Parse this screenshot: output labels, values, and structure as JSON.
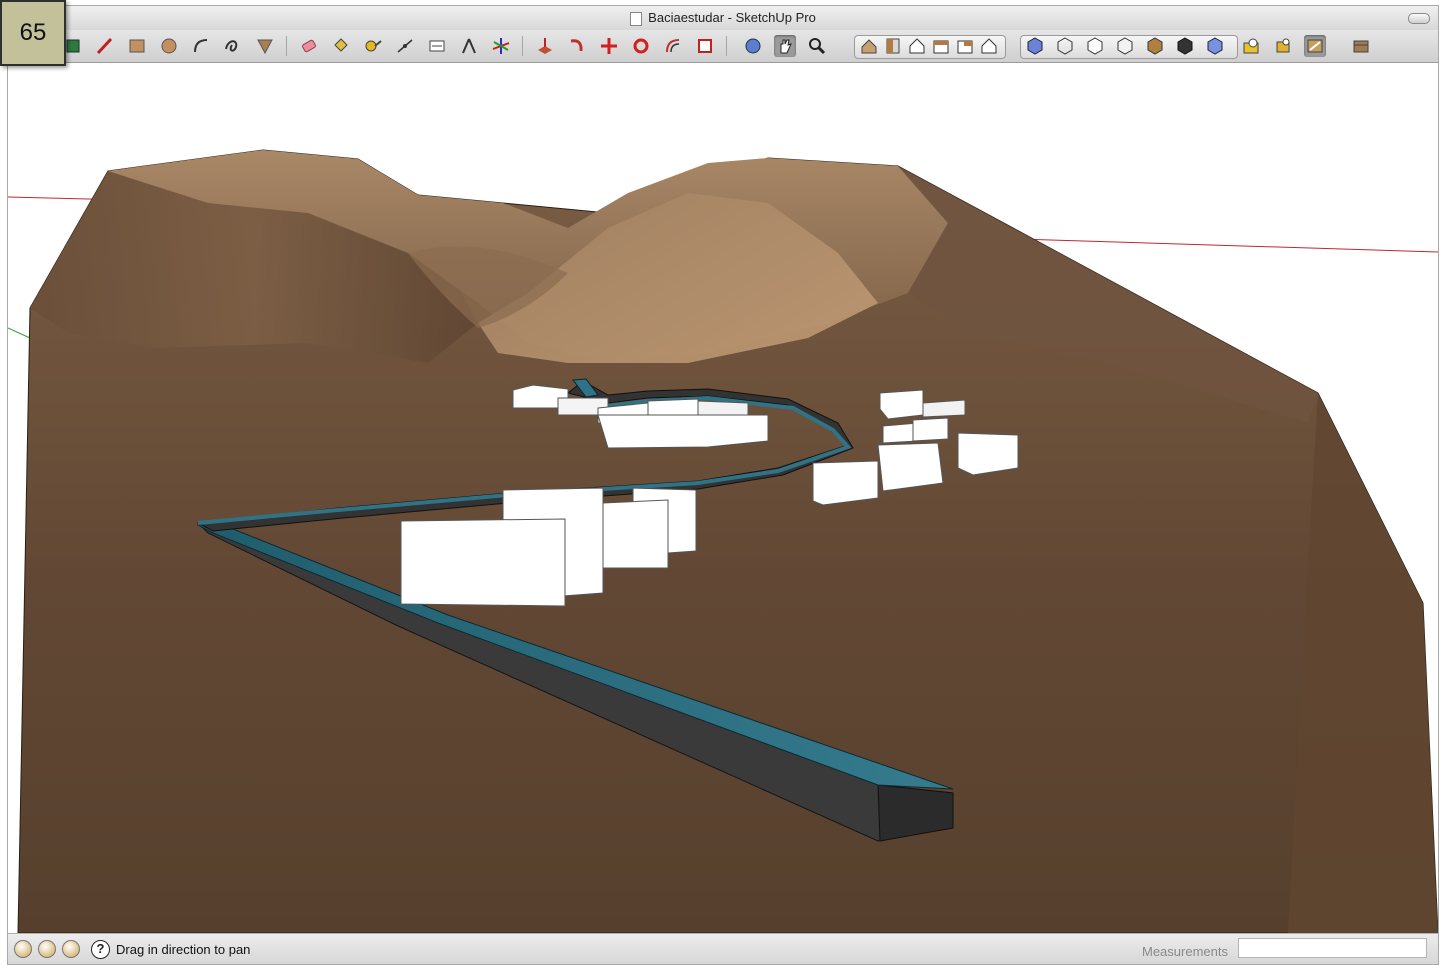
{
  "slide": {
    "number": "65"
  },
  "window": {
    "title": "Baciaestudar - SketchUp Pro"
  },
  "toolbar": {
    "tools": [
      "select-icon",
      "eraser-icon",
      "pencil-icon",
      "rectangle-icon",
      "circle-icon",
      "arc-icon",
      "freehand-icon",
      "polygon-icon",
      "eraser-icon",
      "paint-bucket-icon",
      "tape-measure-icon",
      "dimension-icon",
      "text-icon",
      "protractor-icon",
      "axes-icon",
      "push-pull-icon",
      "follow-me-icon",
      "move-icon",
      "rotate-icon",
      "offset-icon",
      "scale-icon",
      "orbit-icon",
      "pan-icon",
      "zoom-icon"
    ],
    "views": [
      "iso-view-icon",
      "top-view-icon",
      "front-view-icon",
      "right-view-icon",
      "back-view-icon",
      "left-view-icon"
    ],
    "styles": [
      "xray-icon",
      "wireframe-icon",
      "hidden-line-icon",
      "shaded-icon",
      "shaded-textures-icon",
      "monochrome-icon",
      "back-edges-icon"
    ],
    "extras": [
      "photo-textures-icon",
      "components-icon",
      "styles-icon",
      "layers-icon"
    ],
    "active_tool": "pan-icon"
  },
  "status": {
    "message": "Drag in direction to pan",
    "measurements_label": "Measurements",
    "measurements_value": "",
    "icons": [
      "geo-location-icon",
      "credits-icon",
      "user-icon",
      "help-icon"
    ]
  },
  "colors": {
    "terrain_dark": "#5c4431",
    "terrain_light": "#a07e5e",
    "channel_top": "#2c6e80",
    "channel_side": "#3a3a3a",
    "buildings": "#ffffff",
    "axis_red": "#c0282a",
    "axis_green": "#2da02d"
  }
}
